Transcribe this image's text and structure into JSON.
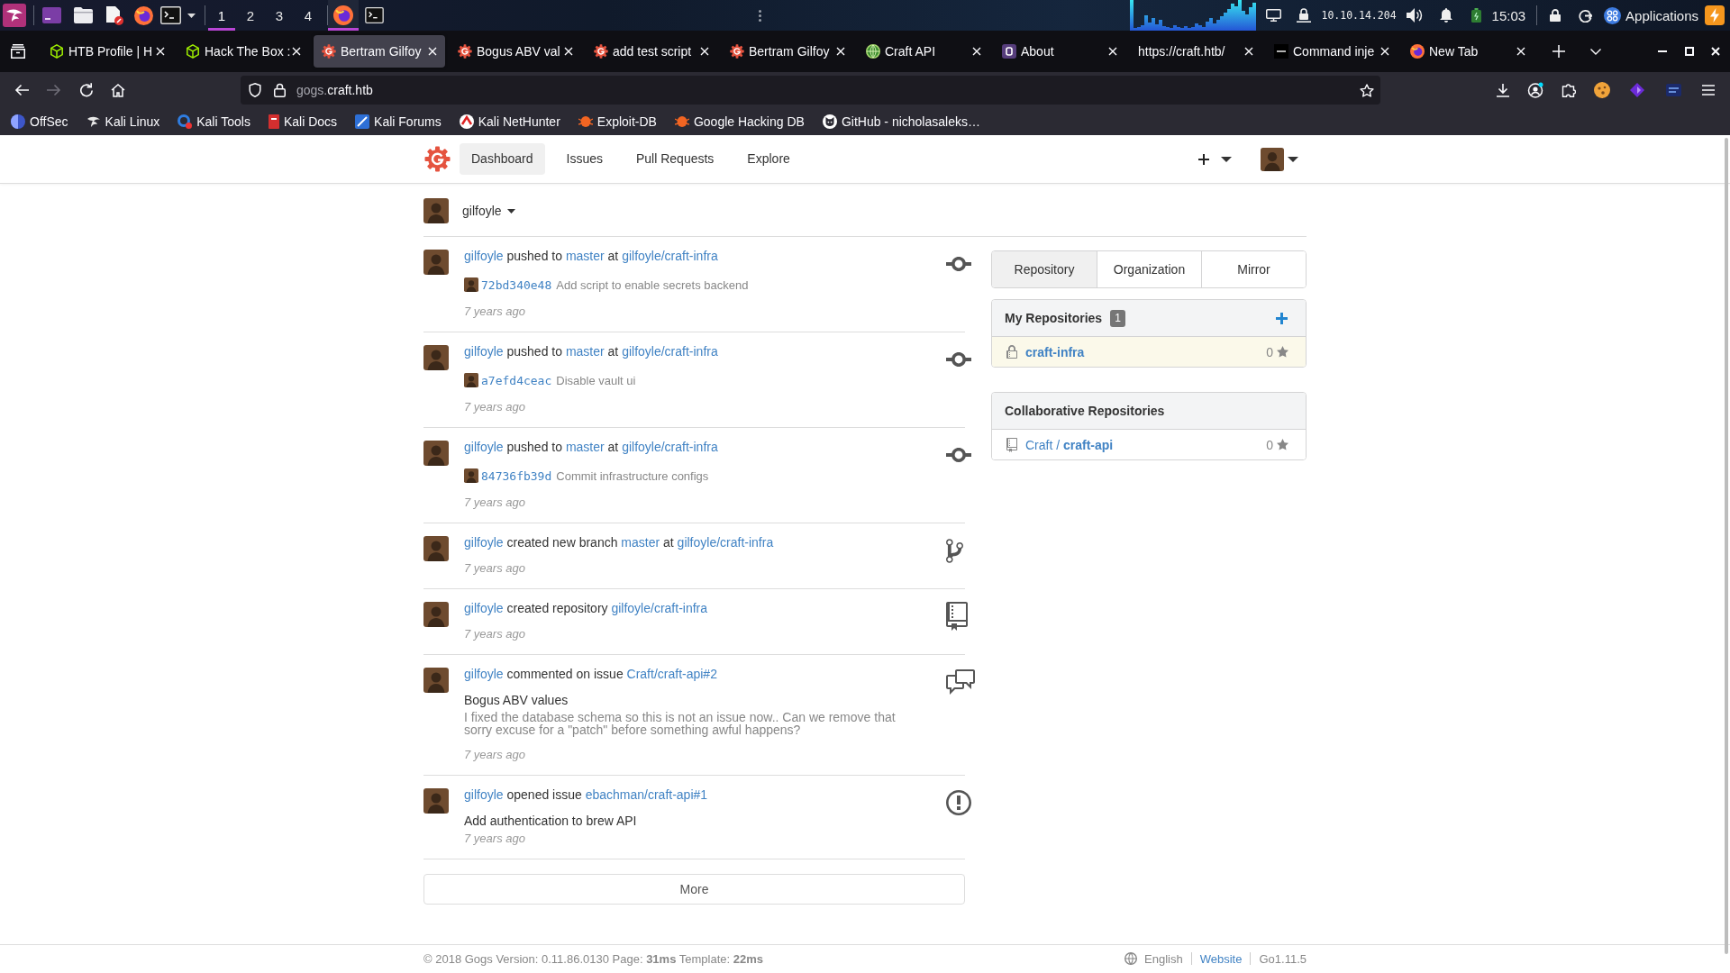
{
  "panel": {
    "workspaces": [
      {
        "label": "1",
        "selected": true
      },
      {
        "label": "2",
        "selected": false
      },
      {
        "label": "3",
        "selected": false
      },
      {
        "label": "4",
        "selected": false
      }
    ],
    "tasks": [
      {
        "kind": "browser",
        "selected": true
      },
      {
        "kind": "terminal",
        "selected": false
      }
    ],
    "vpn_address": "10.10.14.204",
    "clock": "15:03",
    "menu_label": "Applications"
  },
  "browser": {
    "tabs": [
      {
        "title": "HTB Profile | H",
        "kind": "cube",
        "selected": false
      },
      {
        "title": "Hack The Box :",
        "kind": "cube",
        "selected": false
      },
      {
        "title": "Bertram Gilfoy",
        "kind": "gear",
        "selected": true
      },
      {
        "title": "Bogus ABV val",
        "kind": "gear",
        "selected": false
      },
      {
        "title": "add test script",
        "kind": "gear",
        "selected": false
      },
      {
        "title": "Bertram Gilfoy",
        "kind": "gear",
        "selected": false
      },
      {
        "title": "Craft API",
        "kind": "globe",
        "selected": false
      },
      {
        "title": "About",
        "kind": "tile",
        "selected": false
      },
      {
        "title": "https://craft.htb/",
        "selected": false
      },
      {
        "title": "Command inje",
        "kind": "square",
        "selected": false
      },
      {
        "title": "New Tab",
        "kind": "browser",
        "selected": false
      }
    ],
    "url": {
      "dimmed": "gogs.",
      "domain": "craft.htb"
    },
    "bookmarks": [
      {
        "label": "OffSec",
        "kind": "split-circle"
      },
      {
        "label": "Kali Linux",
        "kind": "dragon"
      },
      {
        "label": "Kali Tools",
        "kind": "ring"
      },
      {
        "label": "Kali Docs",
        "kind": "book"
      },
      {
        "label": "Kali Forums",
        "kind": "slash-tile"
      },
      {
        "label": "Kali NetHunter",
        "kind": "emblem"
      },
      {
        "label": "Exploit-DB",
        "kind": "bug"
      },
      {
        "label": "Google Hacking DB",
        "kind": "bug"
      },
      {
        "label": "GitHub - nicholasaleks…",
        "kind": "cat"
      }
    ]
  },
  "header": {
    "nav": [
      {
        "label": "Dashboard",
        "selected": true
      },
      {
        "label": "Issues",
        "selected": false
      },
      {
        "label": "Pull Requests",
        "selected": false
      },
      {
        "label": "Explore",
        "selected": false
      }
    ]
  },
  "context": {
    "user": "gilfoyle"
  },
  "feed": [
    {
      "kind": "push",
      "title": [
        {
          "text": "gilfoyle",
          "kind": "link"
        },
        {
          "text": "pushed to",
          "kind": "text"
        },
        {
          "text": "master",
          "kind": "link"
        },
        {
          "text": "at",
          "kind": "text"
        },
        {
          "text": "gilfoyle/craft-infra",
          "kind": "link"
        }
      ],
      "commits": [
        {
          "sha": "72bd340e48",
          "message": "Add script to enable secrets backend"
        }
      ],
      "time": "7 years ago"
    },
    {
      "kind": "push",
      "title": [
        {
          "text": "gilfoyle",
          "kind": "link"
        },
        {
          "text": "pushed to",
          "kind": "text"
        },
        {
          "text": "master",
          "kind": "link"
        },
        {
          "text": "at",
          "kind": "text"
        },
        {
          "text": "gilfoyle/craft-infra",
          "kind": "link"
        }
      ],
      "commits": [
        {
          "sha": "a7efd4ceac",
          "message": "Disable vault ui"
        }
      ],
      "time": "7 years ago"
    },
    {
      "kind": "push",
      "title": [
        {
          "text": "gilfoyle",
          "kind": "link"
        },
        {
          "text": "pushed to",
          "kind": "text"
        },
        {
          "text": "master",
          "kind": "link"
        },
        {
          "text": "at",
          "kind": "text"
        },
        {
          "text": "gilfoyle/craft-infra",
          "kind": "link"
        }
      ],
      "commits": [
        {
          "sha": "84736fb39d",
          "message": "Commit infrastructure configs"
        }
      ],
      "time": "7 years ago"
    },
    {
      "kind": "create_branch",
      "title": [
        {
          "text": "gilfoyle",
          "kind": "link"
        },
        {
          "text": "created new branch",
          "kind": "text"
        },
        {
          "text": "master",
          "kind": "link"
        },
        {
          "text": "at",
          "kind": "text"
        },
        {
          "text": "gilfoyle/craft-infra",
          "kind": "link"
        }
      ],
      "time": "7 years ago"
    },
    {
      "kind": "create_repo",
      "title": [
        {
          "text": "gilfoyle",
          "kind": "link"
        },
        {
          "text": "created repository",
          "kind": "text"
        },
        {
          "text": "gilfoyle/craft-infra",
          "kind": "link"
        }
      ],
      "time": "7 years ago"
    },
    {
      "kind": "comment_issue",
      "title": [
        {
          "text": "gilfoyle",
          "kind": "link"
        },
        {
          "text": "commented on issue",
          "kind": "text"
        },
        {
          "text": "Craft/craft-api#2",
          "kind": "link"
        }
      ],
      "issue_title": "Bogus ABV values",
      "comment": "I fixed the database schema so this is not an issue now.. Can we remove that sorry excuse for a \"patch\" before something awful happens?",
      "time": "7 years ago"
    },
    {
      "kind": "open_issue",
      "title": [
        {
          "text": "gilfoyle",
          "kind": "link"
        },
        {
          "text": "opened issue",
          "kind": "text"
        },
        {
          "text": "ebachman/craft-api#1",
          "kind": "link"
        }
      ],
      "issue_title": "Add authentication to brew API",
      "time": "7 years ago"
    }
  ],
  "more_button": "More",
  "sidebar": {
    "tabs": [
      {
        "label": "Repository",
        "selected": true
      },
      {
        "label": "Organization",
        "selected": false
      },
      {
        "label": "Mirror",
        "selected": false
      }
    ],
    "repo_lists": [
      {
        "kind": "owned",
        "title": "My Repositories",
        "count": "1",
        "repos": [
          {
            "name": "craft-infra",
            "private": true,
            "star_count": "0"
          }
        ]
      },
      {
        "kind": "collaborative",
        "title": "Collaborative Repositories",
        "repos": [
          {
            "owner_prefix": "Craft /",
            "name": "craft-api",
            "private": false,
            "star_count": "0"
          }
        ]
      }
    ]
  },
  "footer": {
    "version_info": "© 2018 Gogs Version: 0.11.86.0130 Page: **31ms** Template: **22ms**",
    "language": "English",
    "website_link": "Website",
    "go_version": "Go1.11.5"
  }
}
